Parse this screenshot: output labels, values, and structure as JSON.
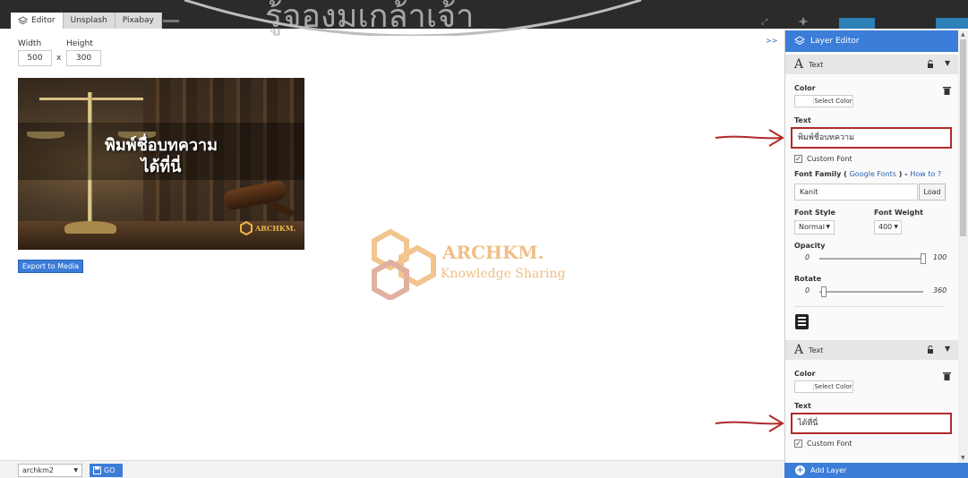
{
  "tabs": [
    {
      "label": "Editor",
      "icon": "layers-icon",
      "active": true
    },
    {
      "label": "Unsplash",
      "active": false
    },
    {
      "label": "Pixabay",
      "active": false
    }
  ],
  "dimensions": {
    "width_label": "Width",
    "height_label": "Height",
    "width_value": "500",
    "height_value": "300",
    "separator": "x"
  },
  "canvas": {
    "line1": "พิมพ์ชื่อบทความ",
    "line2": "ได้ที่นี่",
    "logo_text": "ARCHKM."
  },
  "export_button": "Export to Media",
  "watermark": {
    "arc_text": "รู้จองมเกล้าเจ้า",
    "title": "ARCHKM.",
    "subtitle": "Knowledge Sharing"
  },
  "expand_label": ">>",
  "panel": {
    "title": "Layer Editor",
    "layers": [
      {
        "type_label": "Text",
        "color_label": "Color",
        "select_color": "Select Color",
        "text_label": "Text",
        "text_value": "พิมพ์ชื่อบทความ",
        "custom_font_label": "Custom Font",
        "custom_font_checked": "✓",
        "font_family_label": "Font Family (",
        "google_fonts": "Google Fonts",
        "font_family_sep": ") -",
        "how_to": "How to ?",
        "font_value": "Kanit",
        "load": "Load",
        "font_style_label": "Font Style",
        "font_style_value": "Normal",
        "font_weight_label": "Font Weight",
        "font_weight_value": "400",
        "opacity_label": "Opacity",
        "opacity_min": "0",
        "opacity_max": "100",
        "opacity_level": 1.0,
        "rotate_label": "Rotate",
        "rotate_min": "0",
        "rotate_max": "360",
        "rotate_level": 0.0
      },
      {
        "type_label": "Text",
        "color_label": "Color",
        "select_color": "Select Color",
        "text_label": "Text",
        "text_value": "ได้ที่นี่",
        "custom_font_label": "Custom Font",
        "custom_font_checked": "✓"
      }
    ],
    "add_layer": "Add Layer"
  },
  "bottom": {
    "preset_value": "archkm2",
    "go_label": "GO"
  },
  "colors": {
    "accent": "#3b7dd8",
    "highlight_border": "#b12a2a",
    "arrow": "#b12a2a"
  }
}
